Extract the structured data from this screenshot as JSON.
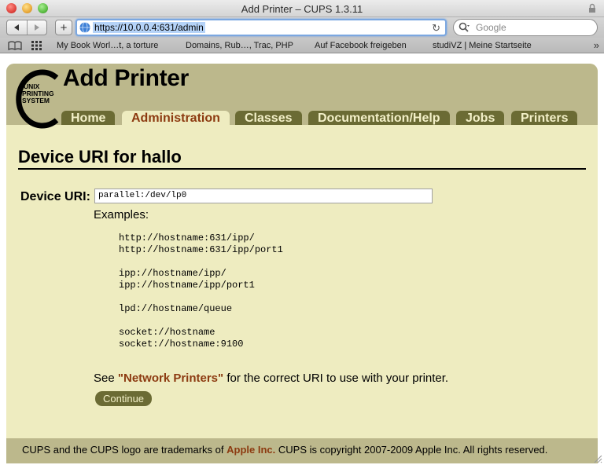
{
  "window": {
    "title": "Add Printer – CUPS 1.3.11"
  },
  "toolbar": {
    "url": "https://10.0.0.4:631/admin",
    "search_placeholder": "Google",
    "add_label": "+"
  },
  "bookmarks": [
    {
      "label": "My Book Worl…t, a torture"
    },
    {
      "label": "Domains, Rub…, Trac, PHP"
    },
    {
      "label": "Auf Facebook freigeben"
    },
    {
      "label": "studiVZ | Meine Startseite"
    }
  ],
  "header": {
    "title": "Add Printer",
    "logo_lines": [
      "UNIX",
      "PRINTING",
      "SYSTEM"
    ]
  },
  "tabs": [
    {
      "label": "Home",
      "active": false
    },
    {
      "label": "Administration",
      "active": true
    },
    {
      "label": "Classes",
      "active": false
    },
    {
      "label": "Documentation/Help",
      "active": false
    },
    {
      "label": "Jobs",
      "active": false
    },
    {
      "label": "Printers",
      "active": false
    }
  ],
  "main": {
    "section_title": "Device URI for hallo",
    "uri_label": "Device URI:",
    "uri_value": "parallel:/dev/lp0",
    "examples_label": "Examples:",
    "examples": [
      [
        "http://hostname:631/ipp/",
        "http://hostname:631/ipp/port1"
      ],
      [
        "ipp://hostname/ipp/",
        "ipp://hostname/ipp/port1"
      ],
      [
        "lpd://hostname/queue"
      ],
      [
        "socket://hostname",
        "socket://hostname:9100"
      ]
    ],
    "see_prefix": "See",
    "see_link": "\"Network Printers\"",
    "see_suffix": "for the correct URI to use with your printer.",
    "continue_label": "Continue"
  },
  "footer": {
    "prefix": "CUPS and the CUPS logo are trademarks of",
    "link": "Apple Inc.",
    "suffix": "CUPS is copyright 2007-2009 Apple Inc. All rights reserved."
  },
  "colors": {
    "page_bg": "#eeecc0",
    "header_bg": "#bcb88c",
    "tab_bg": "#6b6b34",
    "tab_text": "#f3f0c8",
    "link": "#8c3a10"
  }
}
